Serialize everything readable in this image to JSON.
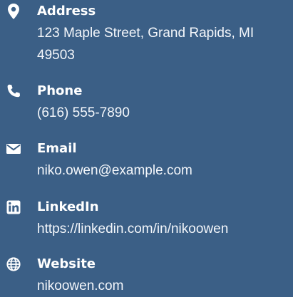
{
  "contact": {
    "items": [
      {
        "icon": "location-pin-icon",
        "label": "Address",
        "value": "123 Maple Street, Grand Rapids, MI 49503"
      },
      {
        "icon": "phone-icon",
        "label": "Phone",
        "value": "(616) 555-7890"
      },
      {
        "icon": "envelope-icon",
        "label": "Email",
        "value": "niko.owen@example.com"
      },
      {
        "icon": "linkedin-icon",
        "label": "LinkedIn",
        "value": "https://linkedin.com/in/nikoowen"
      },
      {
        "icon": "globe-icon",
        "label": "Website",
        "value": "nikoowen.com"
      }
    ]
  },
  "colors": {
    "background": "#3b5f86",
    "text": "#ffffff"
  }
}
